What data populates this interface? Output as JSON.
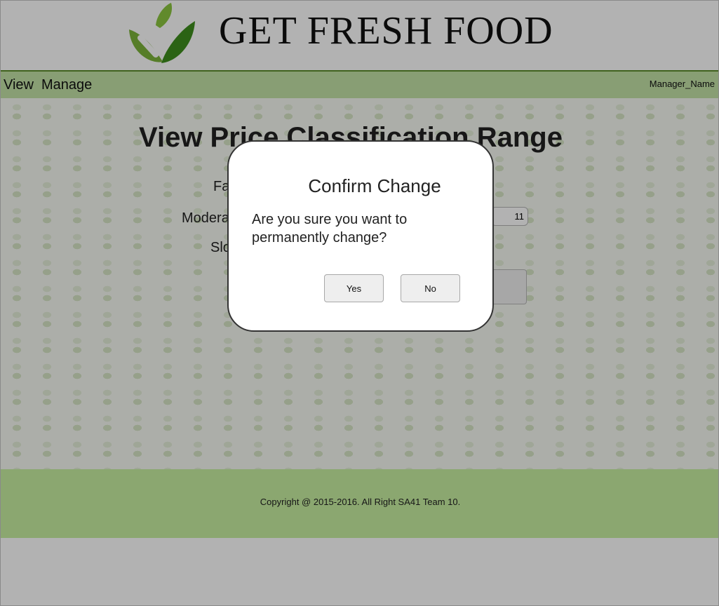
{
  "header": {
    "brand": "GET FRESH FOOD",
    "logo_icon": "leaf-checkmark-icon",
    "colors": {
      "leaf_light": "#8cc63f",
      "leaf_dark": "#3e8e1e"
    }
  },
  "nav": {
    "items": [
      {
        "label": "View"
      },
      {
        "label": "Manage"
      }
    ],
    "user": "Manager_Name",
    "accent": "#c3e3a7"
  },
  "main": {
    "heading": "View Price Classification Range",
    "rows": [
      {
        "label": "Fa"
      },
      {
        "label": "Modera",
        "value": "11"
      },
      {
        "label": "Slo"
      }
    ]
  },
  "footer": {
    "copyright": "Copyright @ 2015-2016. All Right SA41 Team 10.",
    "color": "#c8f0a1"
  },
  "dialog": {
    "title": "Confirm Change",
    "message": "Are you sure you want to permanently change?",
    "yes_label": "Yes",
    "no_label": "No"
  }
}
